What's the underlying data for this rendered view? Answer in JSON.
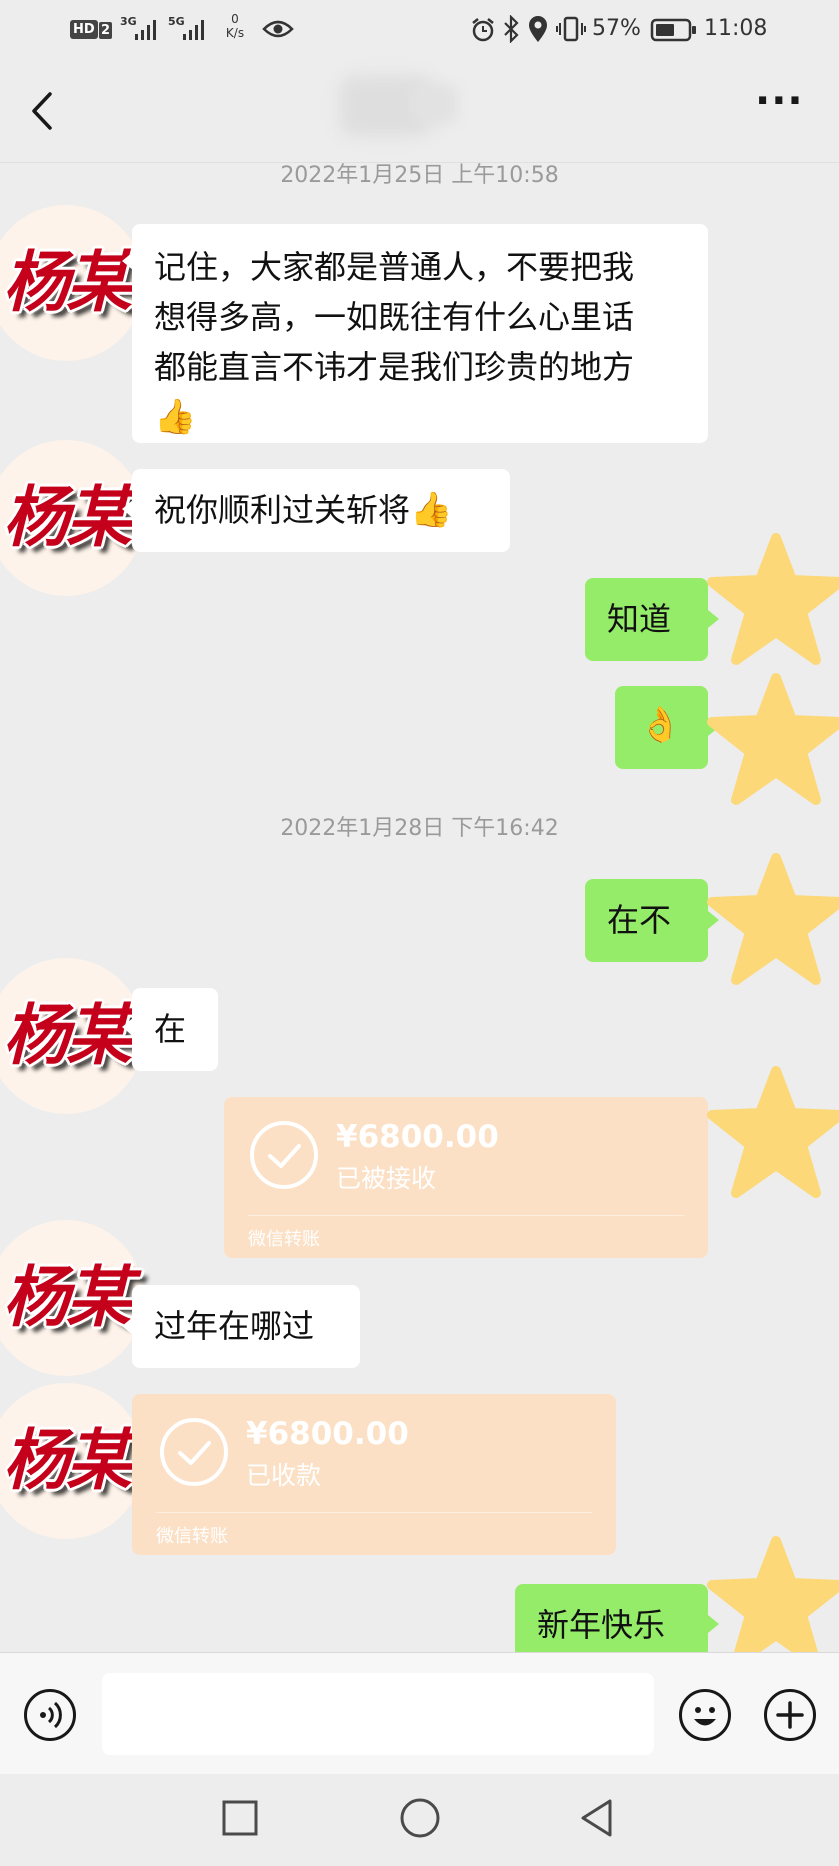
{
  "status_bar": {
    "hd_label": "HD",
    "sim_label": "2",
    "net1_label": "3G",
    "net2_label": "5G",
    "speed_value": "0",
    "speed_unit": "K/s",
    "battery_percent": "57%",
    "time": "11:08"
  },
  "header": {
    "more_label": "···"
  },
  "chat": {
    "timestamp_1": "2022年1月25日 上午10:58",
    "timestamp_2": "2022年1月28日 下午16:42",
    "contact_label": "杨某",
    "messages": [
      {
        "side": "in",
        "lines": [
          "记住，大家都是普通人，不要把我",
          "想得多高，一如既往有什么心里话",
          "都能直言不讳才是我们珍贵的地方"
        ],
        "emoji": "👍"
      },
      {
        "side": "in",
        "text": "祝你顺利过关斩将",
        "emoji": "👍"
      },
      {
        "side": "out",
        "text": "知道"
      },
      {
        "side": "out",
        "emoji": "👌"
      },
      {
        "side": "out",
        "text": "在不"
      },
      {
        "side": "in",
        "text": "在"
      },
      {
        "side": "out",
        "type": "transfer",
        "amount": "¥6800.00",
        "status": "已被接收",
        "label": "微信转账"
      },
      {
        "side": "in",
        "text": "过年在哪过"
      },
      {
        "side": "in",
        "type": "transfer",
        "amount": "¥6800.00",
        "status": "已收款",
        "label": "微信转账"
      },
      {
        "side": "out",
        "text": "新年快乐"
      }
    ]
  },
  "icons": {
    "back": "chevron-left-icon",
    "more": "more-dots-icon",
    "voice": "voice-icon",
    "emoji": "emoji-icon",
    "plus": "plus-icon",
    "nav_recent": "square-icon",
    "nav_home": "circle-icon",
    "nav_back": "triangle-back-icon"
  },
  "colors": {
    "background": "#ededed",
    "bubble_out": "#95ec69",
    "bubble_in": "#ffffff",
    "transfer": "#fbe0c5",
    "contact_label": "#c4001a",
    "star_sticker": "#fcd878"
  }
}
